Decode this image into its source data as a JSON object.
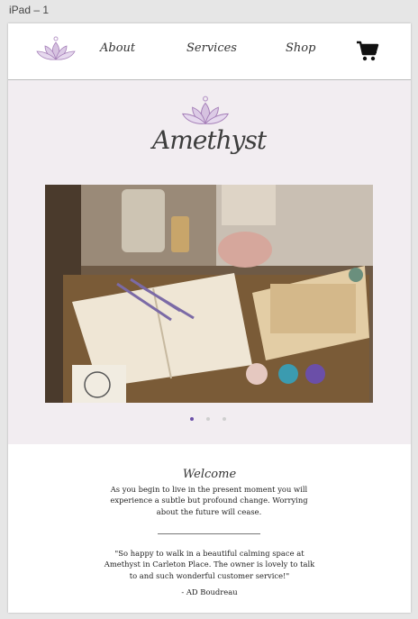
{
  "frame": {
    "label": "iPad – 1"
  },
  "nav": {
    "links": [
      "About",
      "Services",
      "Shop"
    ],
    "logo_icon": "lotus-icon",
    "cart_icon": "shopping-cart-icon"
  },
  "hero": {
    "brand_name": "Amethyst",
    "brand_icon": "lotus-icon",
    "background": "#f2edf1",
    "carousel": {
      "slide_count": 3,
      "active_index": 0,
      "active_color": "#6b4fa8"
    }
  },
  "welcome": {
    "title": "Welcome",
    "lines": [
      "As you begin to live in the present moment you will",
      "experience a subtle but profound change. Worrying",
      "about the future will cease."
    ],
    "quote_lines": [
      "\"So happy to walk in a beautiful calming space at",
      "Amethyst in Carleton Place. The owner is lovely to talk",
      "to and such wonderful customer service!\""
    ],
    "author": "- AD Boudreau"
  },
  "colors": {
    "lotus": "#b99ac9",
    "accent": "#6b4fa8"
  }
}
